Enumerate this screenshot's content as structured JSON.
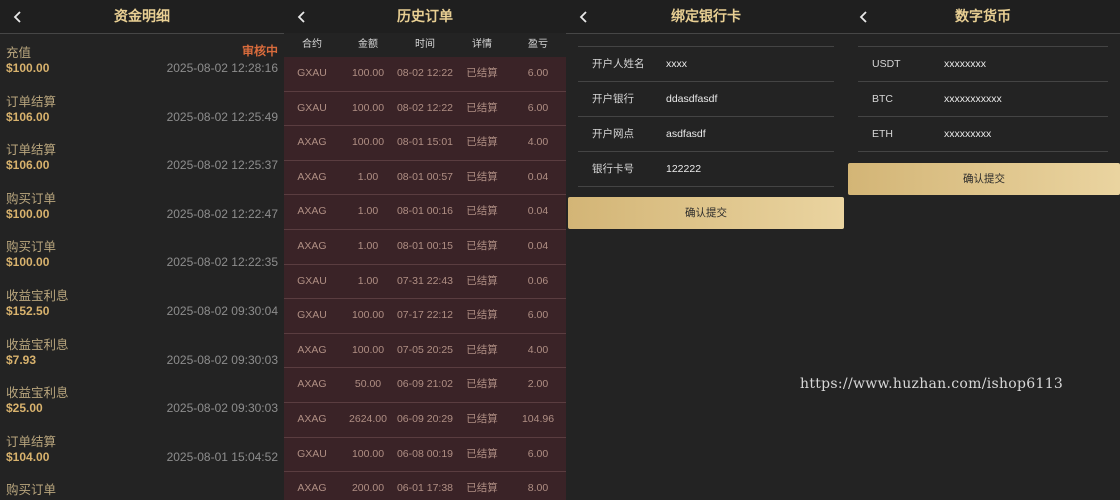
{
  "panels": {
    "funds": {
      "title": "资金明细",
      "items": [
        {
          "title": "充值",
          "amount": "$100.00",
          "time": "2025-08-02 12:28:16",
          "status": "审核中"
        },
        {
          "title": "订单结算",
          "amount": "$106.00",
          "time": "2025-08-02 12:25:49"
        },
        {
          "title": "订单结算",
          "amount": "$106.00",
          "time": "2025-08-02 12:25:37"
        },
        {
          "title": "购买订单",
          "amount": "$100.00",
          "time": "2025-08-02 12:22:47"
        },
        {
          "title": "购买订单",
          "amount": "$100.00",
          "time": "2025-08-02 12:22:35"
        },
        {
          "title": "收益宝利息",
          "amount": "$152.50",
          "time": "2025-08-02 09:30:04"
        },
        {
          "title": "收益宝利息",
          "amount": "$7.93",
          "time": "2025-08-02 09:30:03"
        },
        {
          "title": "收益宝利息",
          "amount": "$25.00",
          "time": "2025-08-02 09:30:03"
        },
        {
          "title": "订单结算",
          "amount": "$104.00",
          "time": "2025-08-01 15:04:52"
        },
        {
          "title": "购买订单",
          "amount": "",
          "time": ""
        }
      ]
    },
    "orders": {
      "title": "历史订单",
      "headers": [
        "合约",
        "金额",
        "时间",
        "详情",
        "盈亏"
      ],
      "rows": [
        [
          "GXAU",
          "100.00",
          "08-02 12:22",
          "已结算",
          "6.00"
        ],
        [
          "GXAU",
          "100.00",
          "08-02 12:22",
          "已结算",
          "6.00"
        ],
        [
          "AXAG",
          "100.00",
          "08-01 15:01",
          "已结算",
          "4.00"
        ],
        [
          "AXAG",
          "1.00",
          "08-01 00:57",
          "已结算",
          "0.04"
        ],
        [
          "AXAG",
          "1.00",
          "08-01 00:16",
          "已结算",
          "0.04"
        ],
        [
          "AXAG",
          "1.00",
          "08-01 00:15",
          "已结算",
          "0.04"
        ],
        [
          "GXAU",
          "1.00",
          "07-31 22:43",
          "已结算",
          "0.06"
        ],
        [
          "GXAU",
          "100.00",
          "07-17 22:12",
          "已结算",
          "6.00"
        ],
        [
          "AXAG",
          "100.00",
          "07-05 20:25",
          "已结算",
          "4.00"
        ],
        [
          "AXAG",
          "50.00",
          "06-09 21:02",
          "已结算",
          "2.00"
        ],
        [
          "AXAG",
          "2624.00",
          "06-09 20:29",
          "已结算",
          "104.96"
        ],
        [
          "GXAU",
          "100.00",
          "06-08 00:19",
          "已结算",
          "6.00"
        ],
        [
          "AXAG",
          "200.00",
          "06-01 17:38",
          "已结算",
          "8.00"
        ]
      ]
    },
    "bank": {
      "title": "绑定银行卡",
      "fields": [
        {
          "label": "开户人姓名",
          "value": "xxxx"
        },
        {
          "label": "开户银行",
          "value": "ddasdfasdf"
        },
        {
          "label": "开户网点",
          "value": "asdfasdf"
        },
        {
          "label": "银行卡号",
          "value": "122222"
        }
      ],
      "submit": "确认提交"
    },
    "crypto": {
      "title": "数字货币",
      "fields": [
        {
          "label": "USDT",
          "value": "xxxxxxxx"
        },
        {
          "label": "BTC",
          "value": "xxxxxxxxxxx"
        },
        {
          "label": "ETH",
          "value": "xxxxxxxxx"
        }
      ],
      "submit": "确认提交"
    }
  },
  "watermark": "https://www.huzhan.com/ishop6113",
  "colors": {
    "accent": "#e8cf93",
    "status": "#d86b3c",
    "order_row": "#3a2327"
  },
  "icons": {
    "back": "chevron-left-icon"
  }
}
